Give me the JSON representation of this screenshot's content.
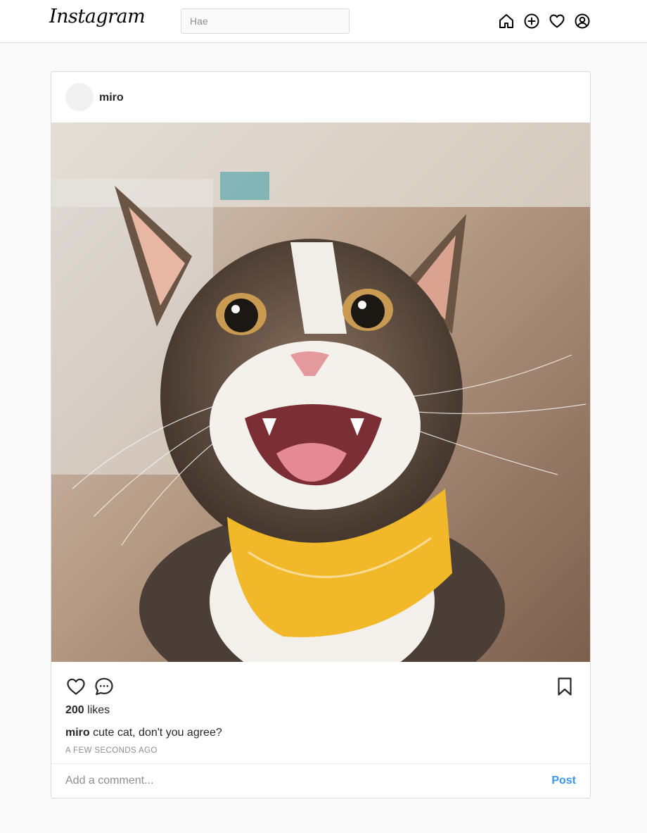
{
  "header": {
    "logo": "Instagram",
    "search_placeholder": "Hae",
    "nav_icons": [
      "home-icon",
      "add-post-icon",
      "activity-heart-icon",
      "profile-icon"
    ]
  },
  "post": {
    "username": "miro",
    "image_alt_subject": "cat-photo",
    "likes_count": "200",
    "likes_word": "likes",
    "caption_user": "miro",
    "caption_text": "cute cat, don't you agree?",
    "timestamp": "A FEW SECONDS AGO",
    "comment_placeholder": "Add a comment...",
    "post_button": "Post",
    "action_icons": [
      "like-heart-icon",
      "comment-icon",
      "bookmark-icon"
    ]
  },
  "colors": {
    "accent": "#3897f0",
    "border": "#dbdbdb",
    "background": "#fafafa",
    "text": "#262626",
    "muted": "#8e8e8e"
  }
}
